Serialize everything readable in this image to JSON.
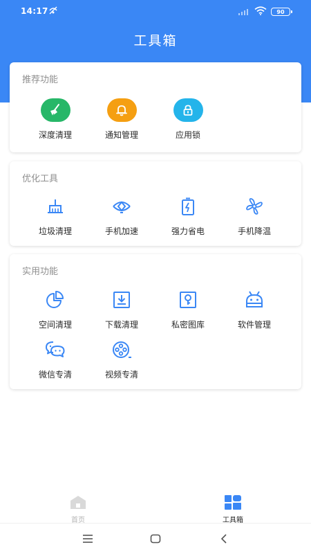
{
  "status_bar": {
    "time": "14:17",
    "battery": "90"
  },
  "header": {
    "title": "工具箱"
  },
  "colors": {
    "primary": "#3a87f5",
    "green": "#27b768",
    "orange": "#f59f12",
    "cyan": "#24b4ea",
    "icon_blue": "#3a87f5"
  },
  "recommended": {
    "title": "推荐功能",
    "items": [
      {
        "label": "深度清理",
        "icon": "broom-icon"
      },
      {
        "label": "通知管理",
        "icon": "bell-icon"
      },
      {
        "label": "应用锁",
        "icon": "lock-icon"
      }
    ]
  },
  "optimize": {
    "title": "优化工具",
    "items": [
      {
        "label": "垃圾清理",
        "icon": "trash-broom-icon"
      },
      {
        "label": "手机加速",
        "icon": "rocket-icon"
      },
      {
        "label": "强力省电",
        "icon": "battery-charge-icon"
      },
      {
        "label": "手机降温",
        "icon": "fan-icon"
      }
    ]
  },
  "utility": {
    "title": "实用功能",
    "items": [
      {
        "label": "空间清理",
        "icon": "pie-chart-icon"
      },
      {
        "label": "下载清理",
        "icon": "download-icon"
      },
      {
        "label": "私密图库",
        "icon": "private-gallery-icon"
      },
      {
        "label": "软件管理",
        "icon": "android-icon"
      },
      {
        "label": "微信专清",
        "icon": "wechat-icon"
      },
      {
        "label": "视频专清",
        "icon": "video-reel-icon"
      }
    ]
  },
  "tabbar": {
    "tabs": [
      {
        "label": "首页",
        "icon": "home-icon",
        "active": false
      },
      {
        "label": "工具箱",
        "icon": "toolbox-grid-icon",
        "active": true
      }
    ]
  }
}
